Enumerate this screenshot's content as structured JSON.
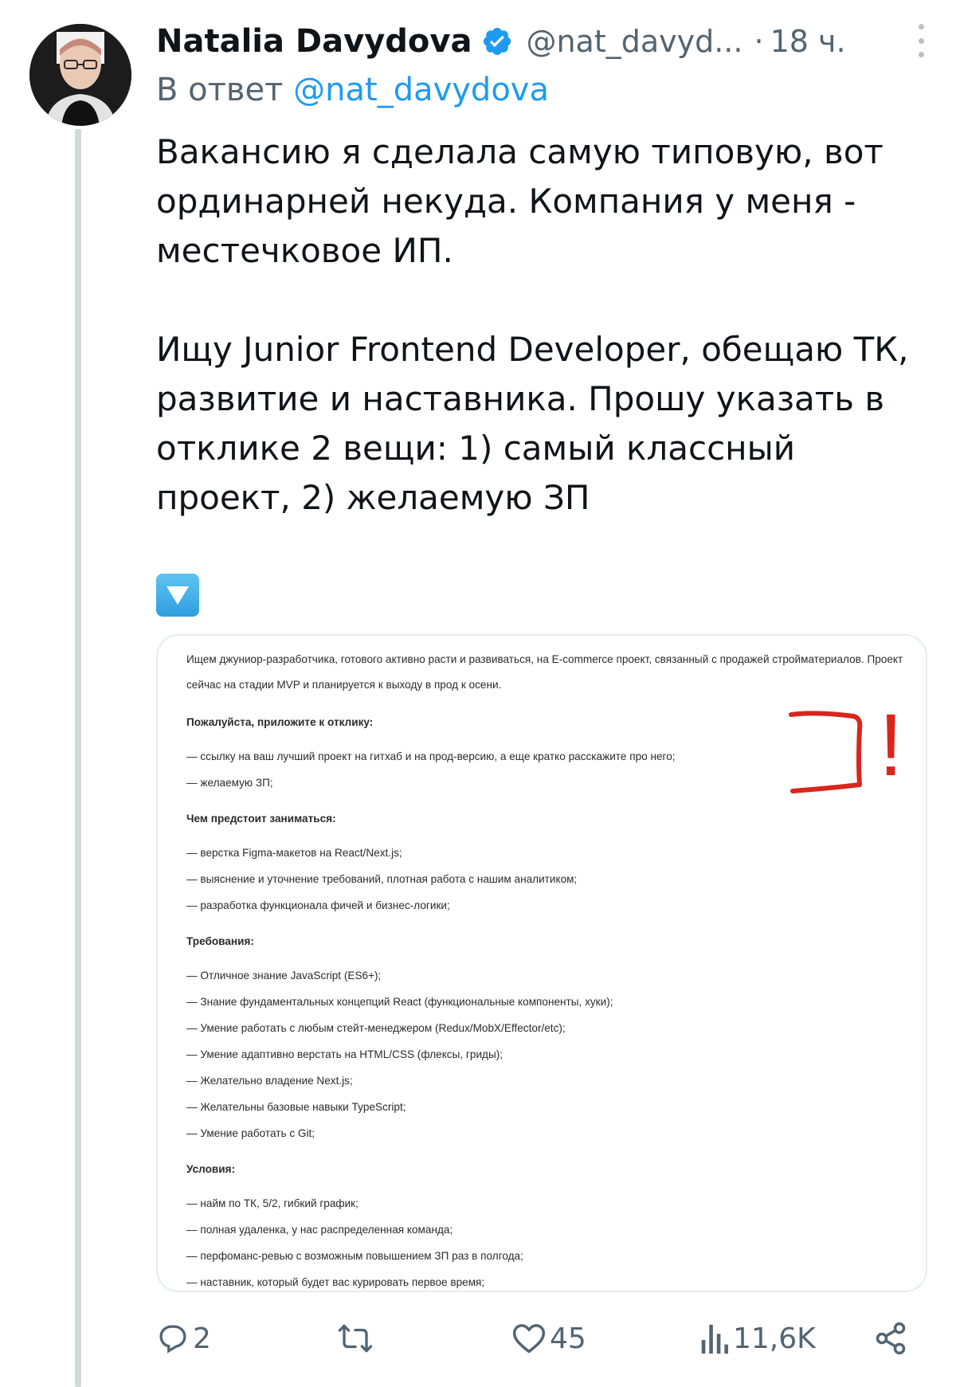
{
  "tweet": {
    "author_name": "Natalia Davydova",
    "handle": "@nat_davyd...",
    "dot": "·",
    "time": "18 ч.",
    "reply_prefix": "В ответ",
    "reply_mention": "@nat_davydova",
    "paragraph1": "Вакансию я сделала самую типовую, вот ординарней некуда. Компания у меня - местечковое ИП.",
    "paragraph2": "Ищу Junior Frontend Developer, обещаю ТК, развитие и наставника. Прошу указать в отклике 2 вещи: 1) самый классный проект, 2) желаемую ЗП"
  },
  "vacancy": {
    "intro": "Ищем джуниор-разработчика, готового активно расти и развиваться, на E-commerce проект, связанный с продажей стройматериалов. Проект сейчас на стадии MVP и планируется к выходу в прод к осени.",
    "attach_heading": "Пожалуйста, приложите к отклику:",
    "attach_items": [
      "— ссылку на ваш лучший проект на гитхаб и на прод-версию, а еще кратко расскажите про него;",
      "— желаемую ЗП;"
    ],
    "tasks_heading": "Чем предстоит заниматься:",
    "tasks_items": [
      "— верстка Figma-макетов на React/Next.js;",
      "— выяснение и уточнение требований, плотная работа с нашим аналитиком;",
      "— разработка функционала фичей и бизнес-логики;"
    ],
    "req_heading": "Требования:",
    "req_items": [
      "— Отличное знание JavaScript (ES6+);",
      "— Знание фундаментальных концепций React (функциональные компоненты, хуки);",
      "— Умение работать с любым стейт-менеджером (Redux/MobX/Effector/etc);",
      "— Умение адаптивно верстать на HTML/CSS (флексы, гриды);",
      "— Желательно владение Next.js;",
      "— Желательны базовые навыки TypeScript;",
      "— Умение работать с Git;"
    ],
    "cond_heading": "Условия:",
    "cond_items": [
      "— найм по ТК, 5/2, гибкий график;",
      "— полная удаленка, у нас распределенная команда;",
      "— перфоманс-ревью с возможным повышением ЗП раз в полгода;",
      "— наставник, который будет вас курировать первое время;"
    ]
  },
  "annotation": {
    "mark_text": "!",
    "color": "#d9261c"
  },
  "actions": {
    "replies": "2",
    "reposts": "",
    "likes": "45",
    "views": "11,6K"
  },
  "icons": {
    "verified": "verified-badge-icon",
    "reply": "reply-icon",
    "repost": "repost-icon",
    "like": "heart-icon",
    "views": "views-icon",
    "share": "share-icon",
    "emoji": "down-arrow-emoji"
  },
  "colors": {
    "accent": "#1d9bf0",
    "secondary_text": "#536471",
    "thread_line": "#cfd9de"
  }
}
